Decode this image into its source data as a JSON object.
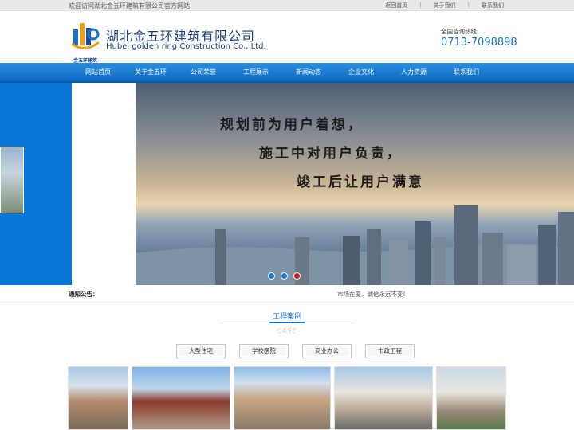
{
  "topbar": {
    "welcome": "欢迎访问湖北金五环建筑有限公司官方网站!",
    "links": [
      "返回首页",
      "关于我们",
      "联系我们"
    ],
    "separator": "|"
  },
  "header": {
    "logo_text": "金五环建筑",
    "company_cn": "湖北金五环建筑有限公司",
    "company_en": "Hubei golden ring Construction Co., Ltd.",
    "hotline_label": "全国咨询热线",
    "hotline_number": "0713-7098898"
  },
  "nav": {
    "items": [
      "网站首页",
      "关于金五环",
      "公司荣誉",
      "工程展示",
      "新闻动态",
      "企业文化",
      "人力资源",
      "联系我们"
    ]
  },
  "banner": {
    "slogans": [
      "规划前为用户着想，",
      "施工中对用户负责，",
      "竣工后让用户满意"
    ],
    "dot_colors": [
      "#1a78c8",
      "#1a78c8",
      "#cc1f1f"
    ]
  },
  "notice": {
    "label": "通知公告：",
    "text": "市场在变，诚信永远不变!"
  },
  "cases": {
    "title": "工程案例",
    "subtitle": "CASE",
    "tabs": [
      "大型住宅",
      "学校医院",
      "商业办公",
      "市政工程"
    ]
  },
  "colors": {
    "nav": "#1a78d0",
    "accent": "#1a73c8",
    "banner_bg": "#0a77d8"
  }
}
